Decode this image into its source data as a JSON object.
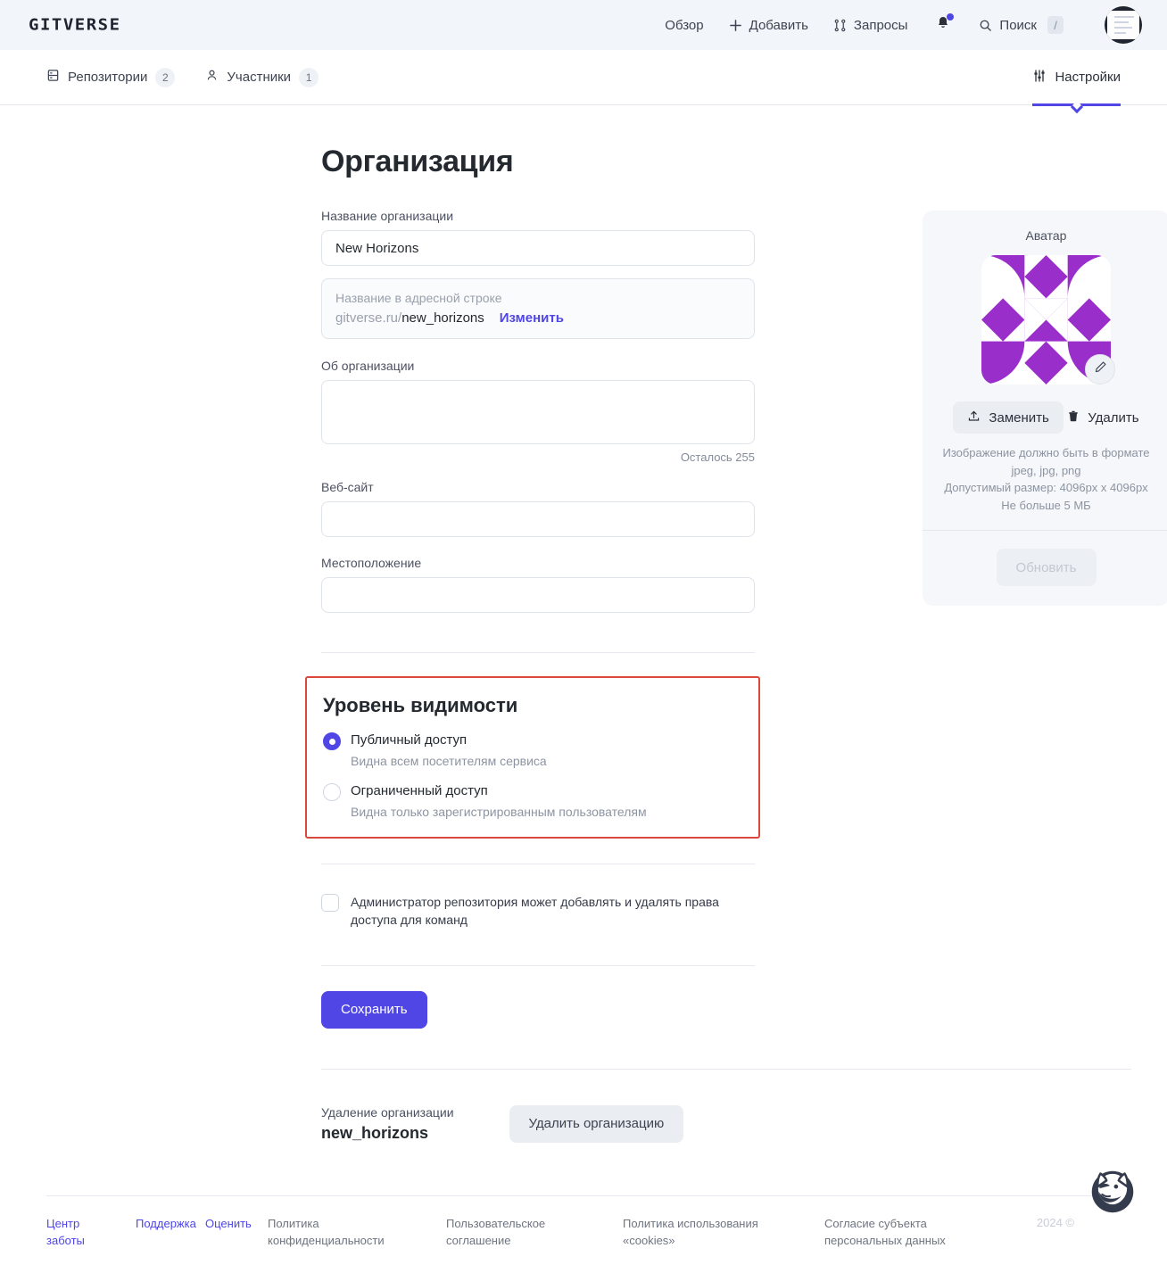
{
  "brand": {
    "logo": "GITVERSE"
  },
  "topnav": {
    "items": [
      {
        "label": "Обзор",
        "icon": null
      },
      {
        "label": "Добавить",
        "icon": "plus-icon"
      },
      {
        "label": "Запросы",
        "icon": "pull-request-icon"
      }
    ],
    "notifications_icon": "bell-icon",
    "search": {
      "label": "Поиск",
      "icon": "search-icon",
      "shortcut": "/"
    },
    "avatar_icon": "user-avatar"
  },
  "tabs": [
    {
      "label": "Репозитории",
      "badge": "2",
      "icon": "repo-icon",
      "active": false
    },
    {
      "label": "Участники",
      "badge": "1",
      "icon": "person-icon",
      "active": false
    },
    {
      "label": "Настройки",
      "badge": null,
      "icon": "sliders-icon",
      "active": true
    }
  ],
  "page": {
    "title": "Организация"
  },
  "form": {
    "name": {
      "label": "Название организации",
      "value": "New Horizons"
    },
    "slug": {
      "placeholder": "Название в адресной строке",
      "domain": "gitverse.ru/",
      "value": "new_horizons",
      "edit_label": "Изменить"
    },
    "about": {
      "label": "Об организации",
      "value": "",
      "counter": "Осталось 255"
    },
    "website": {
      "label": "Веб-сайт",
      "value": ""
    },
    "location": {
      "label": "Местоположение",
      "value": ""
    }
  },
  "visibility": {
    "title": "Уровень видимости",
    "options": [
      {
        "label": "Публичный доступ",
        "desc": "Видна всем посетителям сервиса",
        "selected": true
      },
      {
        "label": "Ограниченный доступ",
        "desc": "Видна только зарегистрированным пользователям",
        "selected": false
      }
    ],
    "highlight_color": "#d9483b"
  },
  "admin_permission": {
    "label": "Администратор репозитория может добавлять и удалять права доступа для команд",
    "checked": false
  },
  "save_label": "Сохранить",
  "delete_section": {
    "label": "Удаление организации",
    "org": "new_horizons",
    "button": "Удалить организацию"
  },
  "avatar_card": {
    "title": "Аватар",
    "edit_icon": "pencil-icon",
    "replace_label": "Заменить",
    "replace_icon": "upload-icon",
    "delete_label": "Удалить",
    "delete_icon": "trash-icon",
    "note_line1": "Изображение должно быть в формате jpeg, jpg, png",
    "note_line2": "Допустимый размер: 4096px x 4096px",
    "note_line3": "Не больше 5 МБ",
    "update_label": "Обновить",
    "pattern_color": "#9a2ecb"
  },
  "footer": {
    "links": [
      {
        "label": "Центр заботы",
        "accent": true
      },
      {
        "label": "Поддержка",
        "accent": true
      },
      {
        "label": "Оценить",
        "accent": true
      },
      {
        "label": "Политика конфиденциальности",
        "accent": false
      },
      {
        "label": "Пользовательское соглашение",
        "accent": false
      },
      {
        "label": "Политика использования «cookies»",
        "accent": false
      },
      {
        "label": "Согласие субъекта персональных данных",
        "accent": false
      }
    ],
    "copyright": "2024 ©",
    "mascot_icon": "husky-logo"
  },
  "colors": {
    "accent": "#4f46e5",
    "purple": "#9a2ecb",
    "danger": "#d9483b"
  }
}
